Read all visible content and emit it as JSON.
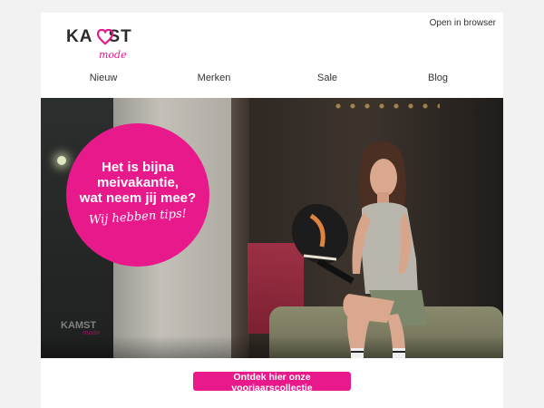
{
  "brand": {
    "logo_text": "KAMST",
    "logo_script": "Mode",
    "accent_color": "#e8198b",
    "logo_icon": "heart-icon"
  },
  "header": {
    "open_in_browser": "Open in browser"
  },
  "nav": {
    "items": [
      {
        "label": "Nieuw"
      },
      {
        "label": "Merken"
      },
      {
        "label": "Sale"
      },
      {
        "label": "Blog"
      }
    ]
  },
  "hero": {
    "headline": "Het is bijna\nmeivakantie,\nwat neem jij mee?",
    "tagline": "Wij hebben tips!",
    "image_subject": "woman-with-padel-racket"
  },
  "cta": {
    "label": "Ontdek hier onze voorjaarscollectie"
  }
}
